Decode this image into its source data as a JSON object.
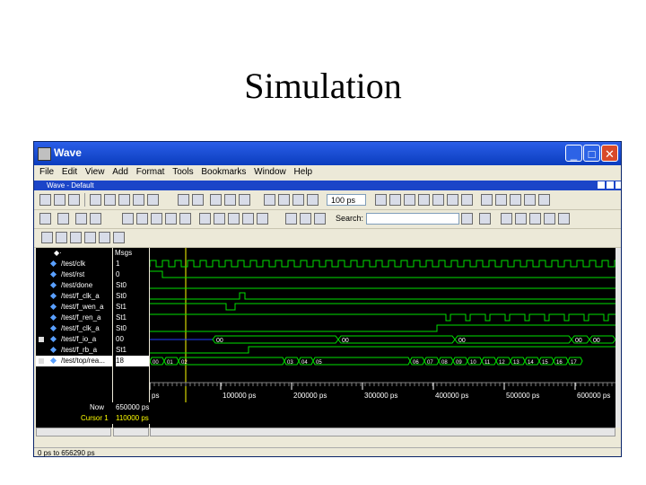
{
  "slide": {
    "title": "Simulation"
  },
  "window": {
    "title": "Wave",
    "controls": {
      "minimize": "_",
      "maximize": "□",
      "close": "✕"
    },
    "menu": [
      "File",
      "Edit",
      "View",
      "Add",
      "Format",
      "Tools",
      "Bookmarks",
      "Window",
      "Help"
    ],
    "subwindow": {
      "title": "Wave - Default"
    },
    "toolbar": {
      "zoom_value": "100 ps",
      "search_placeholder": "Search:"
    },
    "headers": {
      "msgs": "Msgs"
    },
    "signals": [
      {
        "name": "/test/clk",
        "value": "1"
      },
      {
        "name": "/test/rst",
        "value": "0"
      },
      {
        "name": "/test/done",
        "value": "St0"
      },
      {
        "name": "/test/f_clk_a",
        "value": "St0"
      },
      {
        "name": "/test/f_wen_a",
        "value": "St1"
      },
      {
        "name": "/test/f_ren_a",
        "value": "St1"
      },
      {
        "name": "/test/f_clk_a",
        "value": "St0"
      },
      {
        "name": "/test/f_io_a",
        "value": "00"
      },
      {
        "name": "/test/f_rb_a",
        "value": "St1"
      },
      {
        "name": "/test/top/rea...",
        "value": "18"
      }
    ],
    "bus_labels": {
      "f_io_a": [
        "00",
        "00",
        "00",
        "00",
        "00"
      ],
      "counter": [
        "00",
        "01",
        "02",
        "03",
        "04",
        "05",
        "06",
        "07",
        "08",
        "09",
        "10",
        "11",
        "12",
        "13",
        "14",
        "15",
        "16",
        "17"
      ]
    },
    "now_row": {
      "label": "Now",
      "value": "650000 ps"
    },
    "cursor_row": {
      "label": "Cursor 1",
      "value": "110000 ps"
    },
    "time_axis": {
      "ticks": [
        "ps",
        "100000 ps",
        "200000 ps",
        "300000 ps",
        "400000 ps",
        "500000 ps",
        "600000 ps"
      ]
    },
    "status": "0 ps to 656290 ps"
  }
}
